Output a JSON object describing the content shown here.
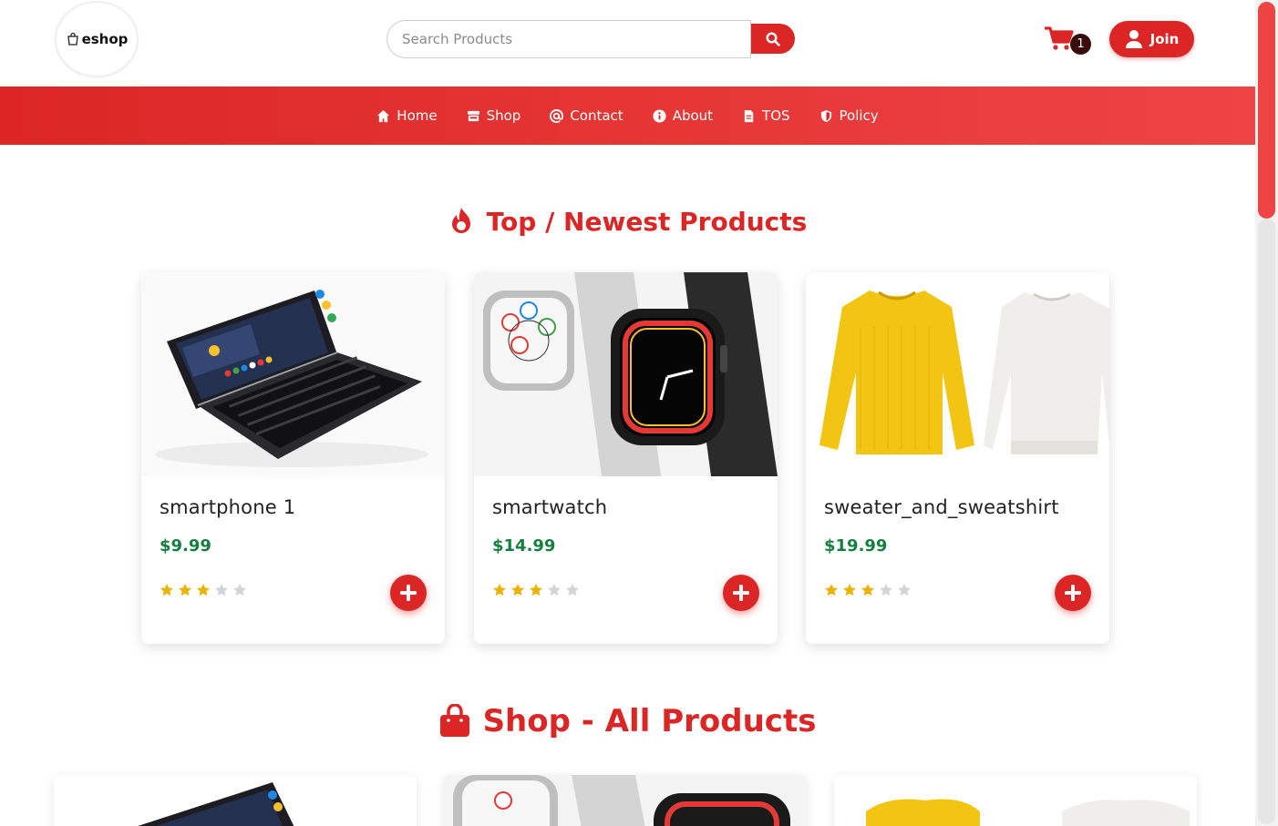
{
  "header": {
    "logo_text": "eshop",
    "search": {
      "placeholder": "Search Products",
      "value": ""
    },
    "cart_count": "1",
    "join_label": "Join"
  },
  "nav": {
    "items": [
      {
        "label": "Home",
        "icon": "home-icon"
      },
      {
        "label": "Shop",
        "icon": "store-icon"
      },
      {
        "label": "Contact",
        "icon": "at-icon"
      },
      {
        "label": "About",
        "icon": "info-icon"
      },
      {
        "label": "TOS",
        "icon": "file-icon"
      },
      {
        "label": "Policy",
        "icon": "shield-icon"
      }
    ]
  },
  "sections": {
    "top": {
      "title": "Top / Newest Products",
      "icon": "fire-icon"
    },
    "shop": {
      "title": "Shop - All Products",
      "icon": "shopping-bag-icon"
    }
  },
  "products": [
    {
      "name": "smartphone 1",
      "price": "$9.99",
      "rating": 3,
      "max_rating": 5,
      "image": "smartphone-keyboard"
    },
    {
      "name": "smartwatch",
      "price": "$14.99",
      "rating": 3,
      "max_rating": 5,
      "image": "smartwatches"
    },
    {
      "name": "sweater_and_sweatshirt",
      "price": "$19.99",
      "rating": 3,
      "max_rating": 5,
      "image": "sweaters"
    }
  ],
  "colors": {
    "brand_red": "#dc2626",
    "price_green": "#15803d",
    "star_gold": "#eab308",
    "star_empty": "#d1d5db"
  }
}
